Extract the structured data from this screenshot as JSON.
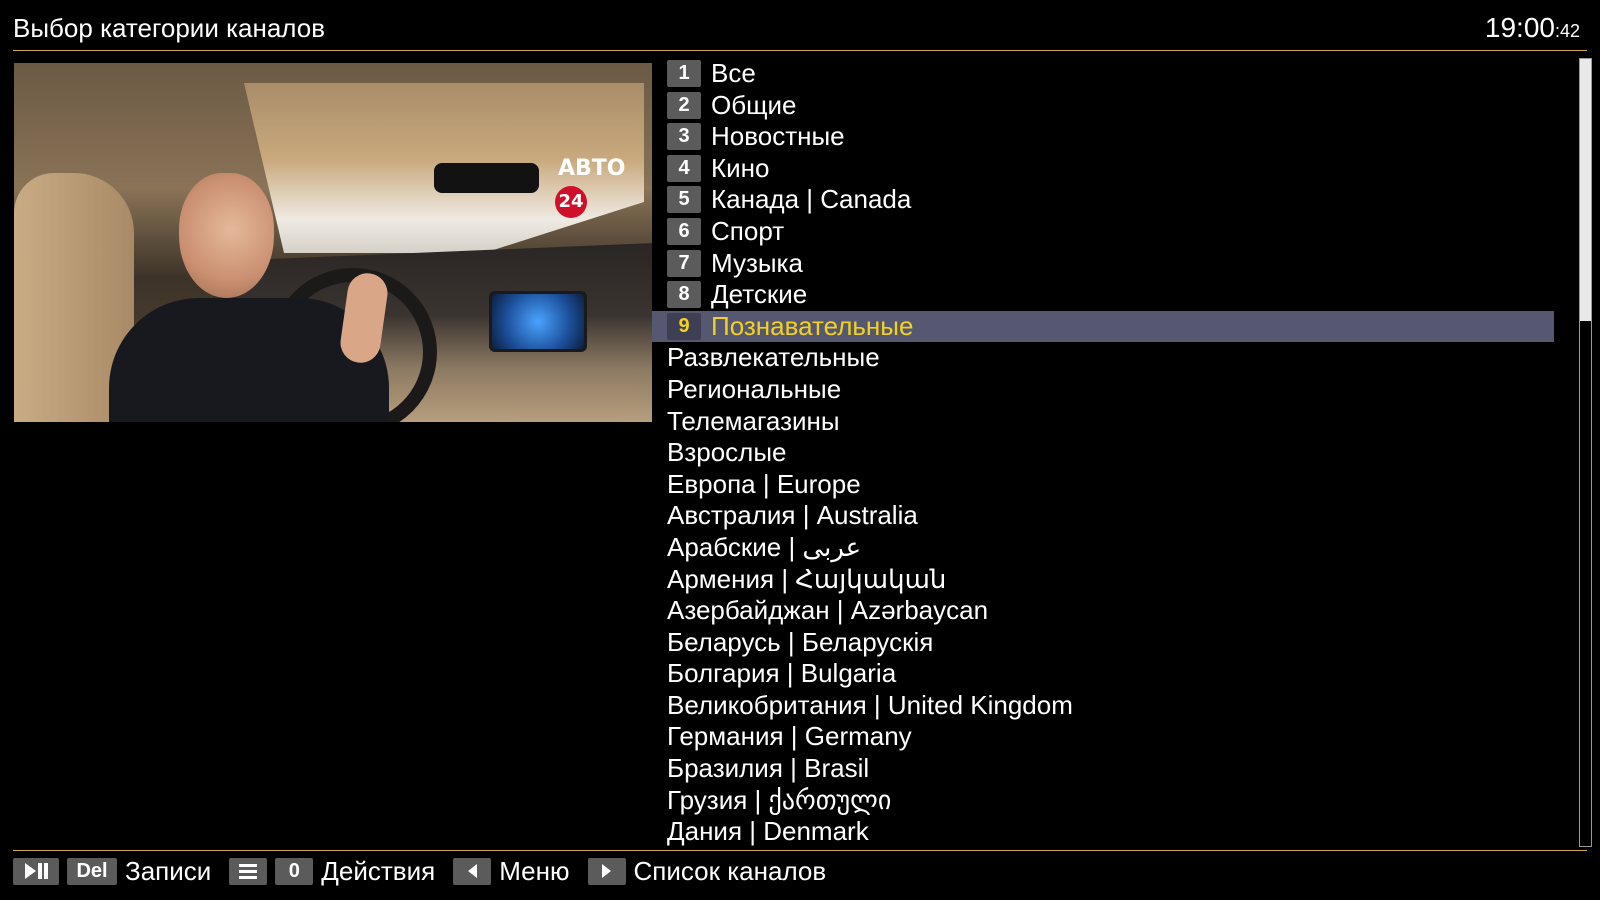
{
  "header": {
    "title": "Выбор категории каналов",
    "clock_main": "19:00",
    "clock_seconds": ":42"
  },
  "preview": {
    "channel_logo_text": "АВТО",
    "channel_logo_number": "24"
  },
  "categories": [
    {
      "num": "1",
      "label": "Все"
    },
    {
      "num": "2",
      "label": "Общие"
    },
    {
      "num": "3",
      "label": "Новостные"
    },
    {
      "num": "4",
      "label": "Кино"
    },
    {
      "num": "5",
      "label": "Канада | Canada"
    },
    {
      "num": "6",
      "label": "Спорт"
    },
    {
      "num": "7",
      "label": "Музыка"
    },
    {
      "num": "8",
      "label": "Детские"
    },
    {
      "num": "9",
      "label": "Познавательные",
      "selected": true
    },
    {
      "num": "",
      "label": "Развлекательные"
    },
    {
      "num": "",
      "label": "Региональные"
    },
    {
      "num": "",
      "label": "Телемагазины"
    },
    {
      "num": "",
      "label": "Взрослые"
    },
    {
      "num": "",
      "label": "Европа | Europe"
    },
    {
      "num": "",
      "label": "Австралия | Australia"
    },
    {
      "num": "",
      "label": "Арабские | عربى"
    },
    {
      "num": "",
      "label": "Армения | Հայկական"
    },
    {
      "num": "",
      "label": "Азербайджан | Azərbaycan"
    },
    {
      "num": "",
      "label": "Беларусь | Беларускія"
    },
    {
      "num": "",
      "label": "Болгария | Bulgaria"
    },
    {
      "num": "",
      "label": "Великобритания | United Kingdom"
    },
    {
      "num": "",
      "label": "Германия | Germany"
    },
    {
      "num": "",
      "label": "Бразилия | Brasil"
    },
    {
      "num": "",
      "label": "Грузия | ქართული"
    },
    {
      "num": "",
      "label": "Дания | Denmark"
    }
  ],
  "footer": {
    "del_key": "Del",
    "recordings_label": "Записи",
    "zero_key": "0",
    "actions_label": "Действия",
    "menu_label": "Меню",
    "channel_list_label": "Список каналов"
  },
  "colors": {
    "selected_text": "#f2d21e",
    "selected_row_bg": "#565872",
    "separator": "#c8a94a",
    "key_bg": "#5b5b5b"
  },
  "icons": [
    "play-pause-icon",
    "menu-icon",
    "arrow-left-icon",
    "arrow-right-icon"
  ]
}
